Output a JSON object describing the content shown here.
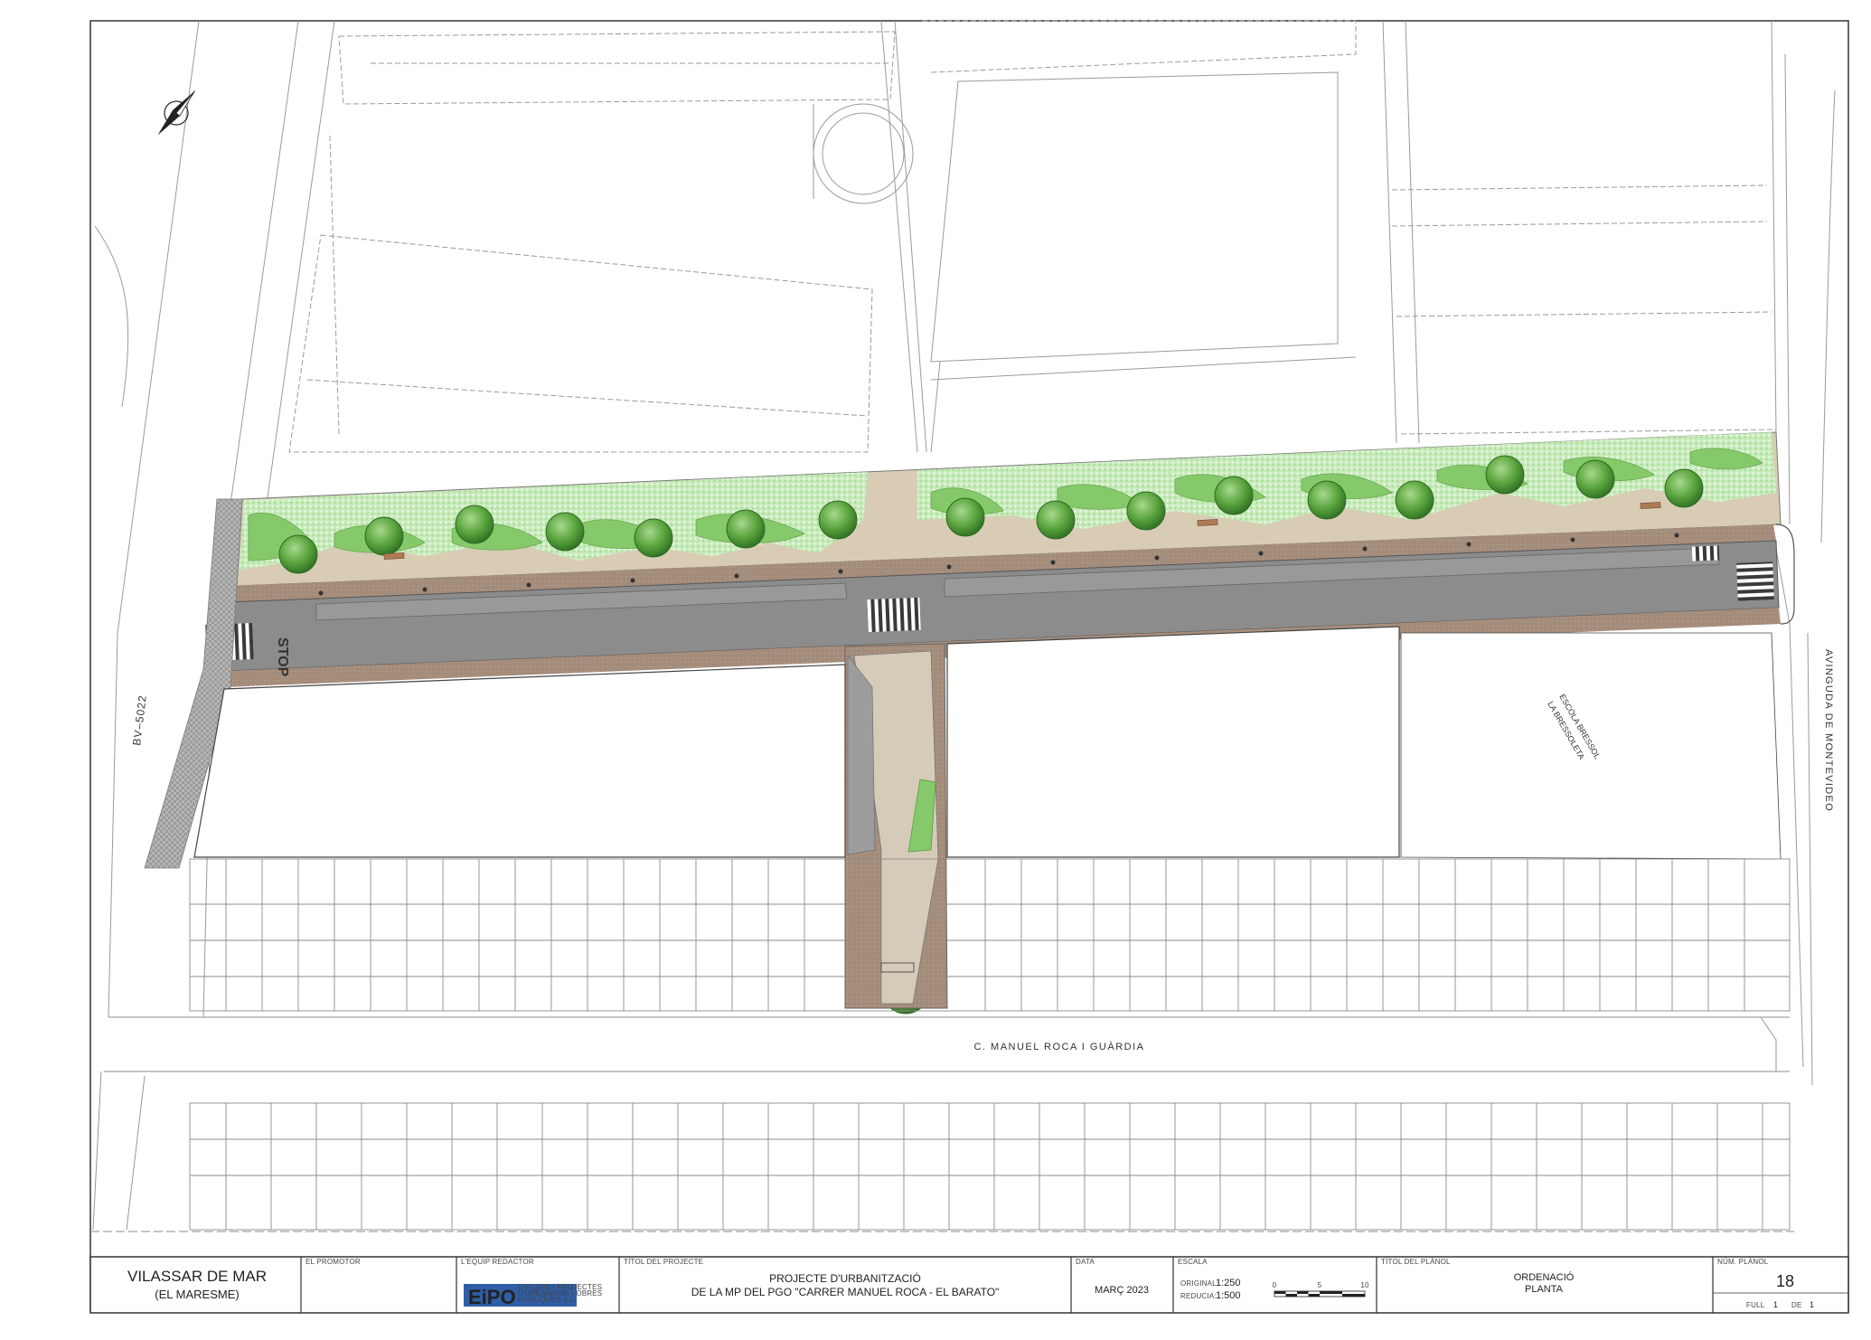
{
  "plan": {
    "street_main": "C. MANUEL ROCA I GUÀRDIA",
    "street_left": "BV–5022",
    "street_right": "AVINGUDA DE MONTEVIDEO",
    "school_line1": "ESCOLA BRESSOL",
    "school_line2": "LA BRESSOLETA",
    "stop_marking": "STOP"
  },
  "titleblock": {
    "municipality": "VILASSAR DE MAR",
    "region": "(EL MARESME)",
    "promoter_label": "EL PROMOTOR",
    "team_label": "L'EQUIP REDACTOR",
    "logo_text": "EiPO",
    "logo_sub1": "ESTUDIS I PROJECTES",
    "logo_sub2": "D'URBANISME I OBRES",
    "logo_sub3": "PÚBLIQUES S.L.",
    "project_label": "TÍTOL DEL PROJECTE",
    "project_line1": "PROJECTE D'URBANITZACIÓ",
    "project_line2": "DE LA MP DEL PGO \"CARRER MANUEL ROCA - EL BARATO\"",
    "date_label": "DATA",
    "date_value": "MARÇ 2023",
    "scale_label": "ESCALA",
    "scale_original_label": "ORIGINAL:",
    "scale_original_value": "1:250",
    "scale_reduced_label": "REDUCIA:",
    "scale_reduced_value": "1:500",
    "scalebar_ticks": [
      "0",
      "5",
      "10"
    ],
    "plan_title_label": "TÍTOL DEL PLÀNOL",
    "plan_title_line1": "ORDENACIÓ",
    "plan_title_line2": "PLANTA",
    "plan_num_label": "NÚM. PLÀNOL",
    "plan_num_value": "18",
    "sheet_label": "FULL",
    "sheet_value": "1",
    "sheet_of_label": "DE",
    "sheet_total": "1"
  },
  "colors": {
    "asphalt": "#8c8c8c",
    "sidewalk": "#a89080",
    "path": "#d6cbb8",
    "planting": "#86c96a",
    "tree": "#3e8a2e",
    "lines": "#555555"
  }
}
